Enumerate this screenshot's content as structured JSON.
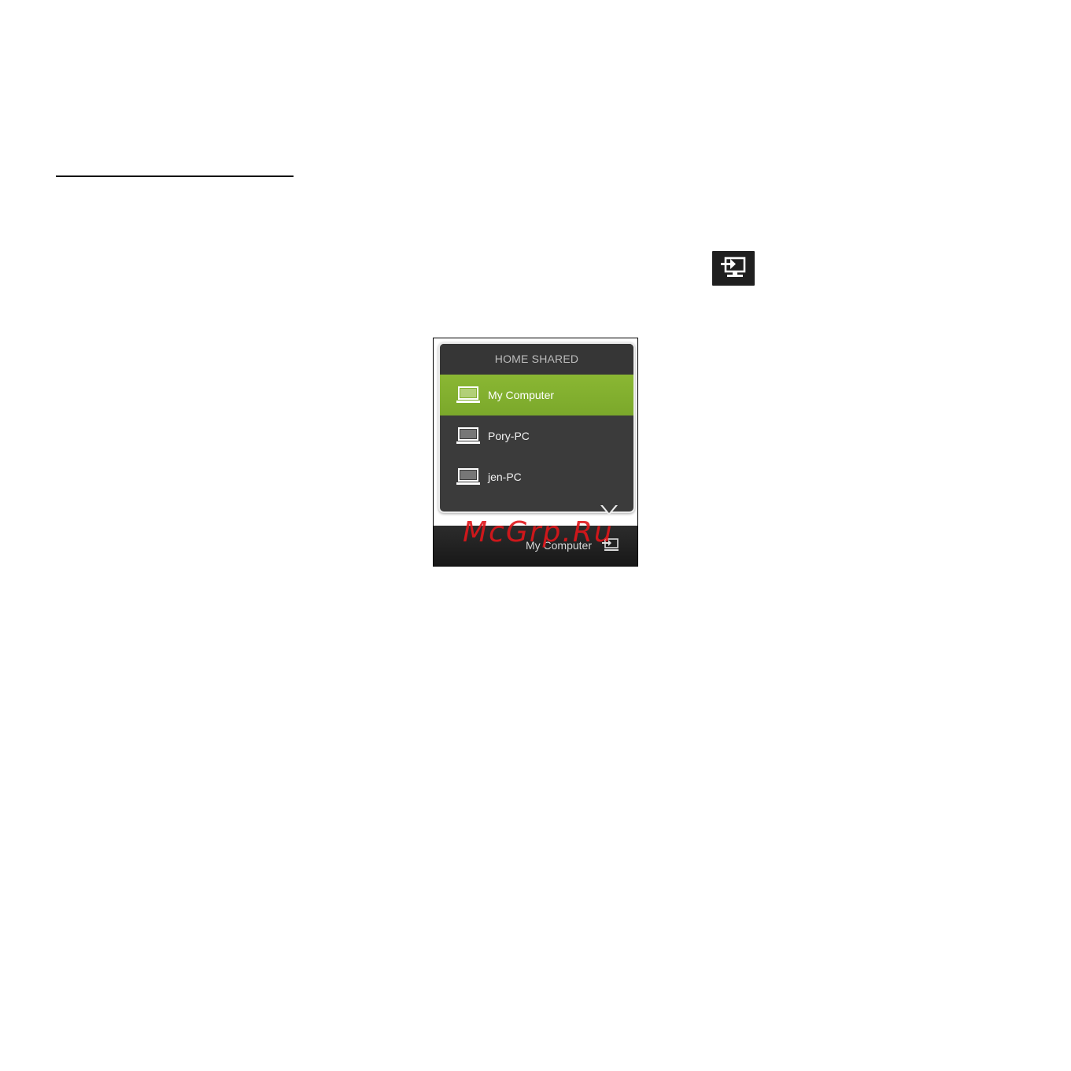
{
  "page": {
    "source_icon": "monitor-input-icon"
  },
  "popup": {
    "header": "HOME SHARED",
    "items": [
      {
        "label": "My Computer",
        "icon": "laptop-icon",
        "selected": true
      },
      {
        "label": "Pory-PC",
        "icon": "laptop-icon",
        "selected": false
      },
      {
        "label": "jen-PC",
        "icon": "laptop-icon",
        "selected": false
      }
    ]
  },
  "bottom_bar": {
    "label": "My Computer",
    "icon": "monitor-input-icon"
  },
  "watermark": "McGrp.Ru",
  "colors": {
    "accent_green": "#8ab733",
    "popup_bg": "#3b3b3b",
    "bar_bg": "#1f1f1f",
    "watermark_red": "#e0161a"
  }
}
